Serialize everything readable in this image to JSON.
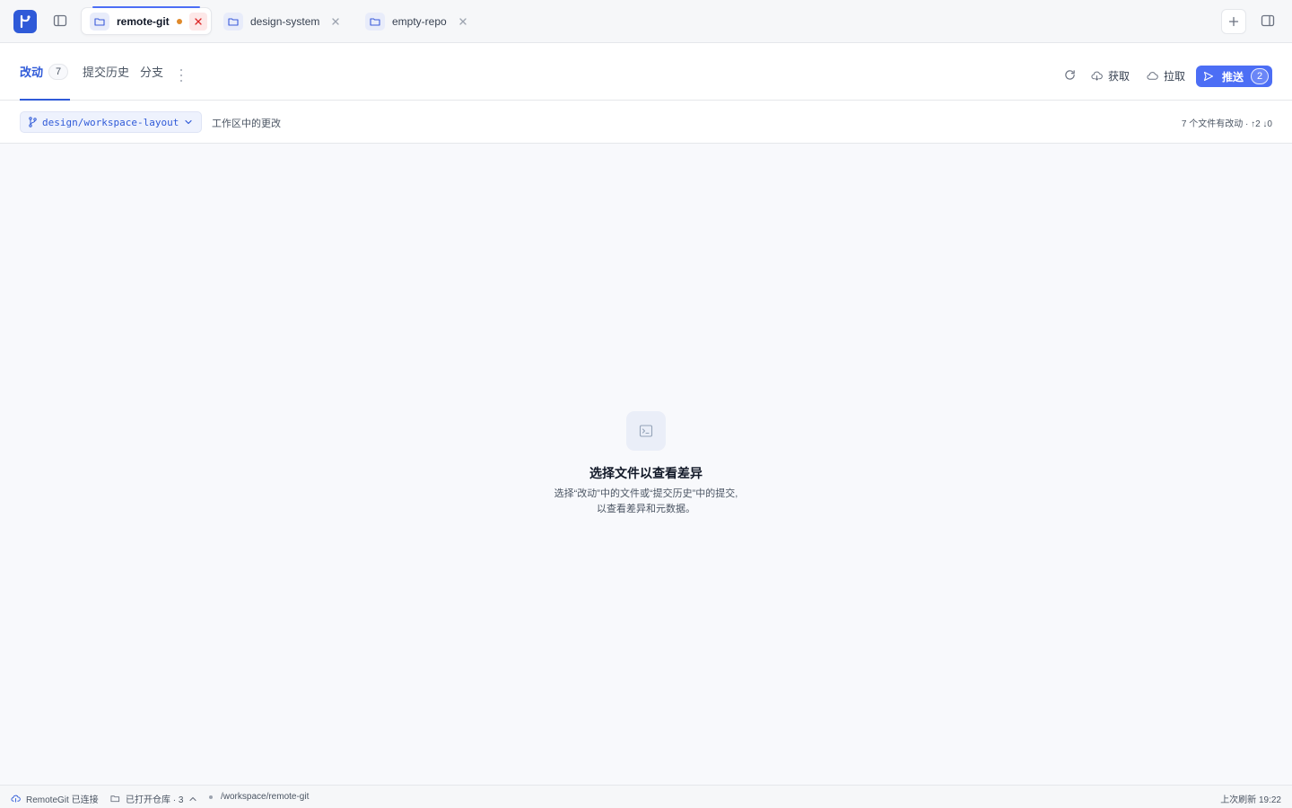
{
  "titlebar": {
    "tabs": [
      {
        "label": "remote-git",
        "active": true,
        "modified": true
      },
      {
        "label": "design-system",
        "active": false
      },
      {
        "label": "empty-repo",
        "active": false
      }
    ]
  },
  "toolbar": {
    "views": [
      {
        "label": "改动",
        "count": "7",
        "active": true
      },
      {
        "label": "提交历史"
      },
      {
        "label": "分支"
      }
    ],
    "fetch_label": "获取",
    "pull_label": "拉取",
    "push_label": "推送",
    "push_count": "2"
  },
  "branchbar": {
    "branch": "design/workspace-layout",
    "description": "工作区中的更改",
    "summary": "7 个文件有改动 · ↑2 ↓0"
  },
  "empty_state": {
    "title": "选择文件以查看差异",
    "line1": "选择“改动”中的文件或“提交历史”中的提交,",
    "line2": "以查看差异和元数据。"
  },
  "statusbar": {
    "connection": "RemoteGit 已连接",
    "open_repos": "已打开仓库 · 3",
    "path": "/workspace/remote-git",
    "last_refresh": "上次刷新 19:22"
  },
  "colors": {
    "accent": "#2f5ad8",
    "push": "#4c6ef5",
    "modified_dot": "#e08a2b",
    "close_active": "#dc2626"
  },
  "icons": [
    "app-logo-icon",
    "sidebar-toggle-icon",
    "folder-icon",
    "close-icon",
    "plus-icon",
    "panel-right-icon",
    "more-vertical-icon",
    "refresh-icon",
    "cloud-download-icon",
    "cloud-icon",
    "send-icon",
    "git-branch-icon",
    "chevron-down-icon",
    "terminal-icon",
    "folder-open-icon",
    "chevron-up-icon"
  ]
}
